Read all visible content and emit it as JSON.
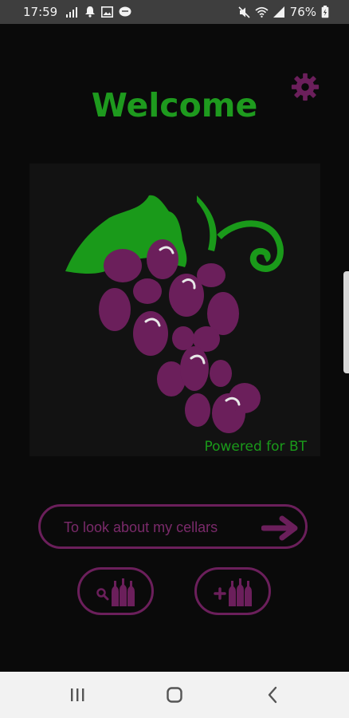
{
  "status_bar": {
    "time": "17:59",
    "battery_percent": "76%",
    "left_icons": [
      "signal-bars-icon",
      "bell-icon",
      "image-icon",
      "chat-bubble-icon"
    ],
    "right_icons": [
      "mute-icon",
      "wifi-icon",
      "cellular-signal-icon",
      "battery-charging-icon"
    ]
  },
  "main": {
    "title": "Welcome",
    "powered_text": "Powered for BT",
    "cellars_button_label": "To look about my cellars"
  },
  "colors": {
    "title_green": "#1e9a1e",
    "leaf_green": "#1a9a1a",
    "grape_purple": "#6b1f5b",
    "background": "#0a0a0a"
  },
  "icons": {
    "settings": "gear-icon",
    "logo": "grapes-logo",
    "cellars_arrow": "arrow-right-icon",
    "search_bottles": "search-bottles-icon",
    "add_bottles": "add-bottles-icon",
    "nav_recents": "recents-icon",
    "nav_home": "home-icon",
    "nav_back": "back-icon"
  }
}
